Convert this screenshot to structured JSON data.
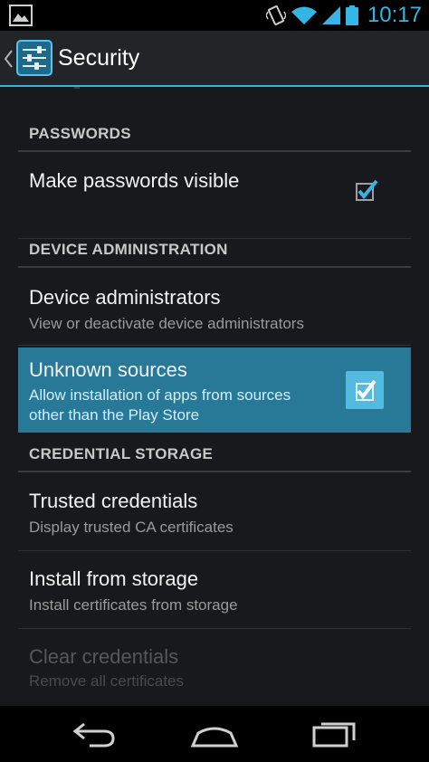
{
  "status_bar": {
    "time": "10:17",
    "icons": [
      "gallery-notification-icon",
      "vibrate-icon",
      "wifi-icon",
      "cell-signal-icon",
      "battery-icon"
    ],
    "accent": "#33b5e5"
  },
  "action_bar": {
    "title": "Security",
    "icon": "settings-sliders-icon"
  },
  "sections": {
    "passwords": {
      "header": "PASSWORDS",
      "make_visible": {
        "title": "Make passwords visible",
        "checked": true
      }
    },
    "device_admin": {
      "header": "DEVICE ADMINISTRATION",
      "administrators": {
        "title": "Device administrators",
        "summary": "View or deactivate device administrators"
      },
      "unknown_sources": {
        "title": "Unknown sources",
        "summary_line1": "Allow installation of apps from sources",
        "summary_line2": "other than the Play Store",
        "checked": true
      }
    },
    "credential_storage": {
      "header": "CREDENTIAL STORAGE",
      "trusted": {
        "title": "Trusted credentials",
        "summary": "Display trusted CA certificates"
      },
      "install": {
        "title": "Install from storage",
        "summary": "Install certificates from storage"
      },
      "clear": {
        "title": "Clear credentials",
        "summary": "Remove all certificates",
        "enabled": false
      }
    }
  },
  "nav_bar": {
    "buttons": [
      "back-icon",
      "home-icon",
      "recent-apps-icon"
    ]
  },
  "colors": {
    "accent": "#33b5e5",
    "background": "#17191c",
    "action_bar": "#222427"
  }
}
